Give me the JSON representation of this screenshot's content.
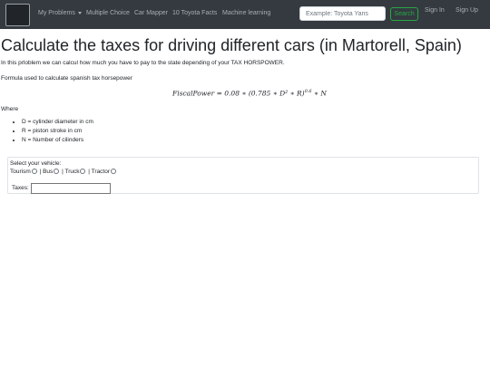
{
  "nav": {
    "items": [
      "My Problems",
      "Multiple Choice",
      "Car Mapper",
      "10 Toyota Facts",
      "Machine learning"
    ],
    "search_placeholder": "Example: Toyota Yaris",
    "search_button": "Search",
    "sign_in": "Sign In",
    "sign_up": "Sign Up"
  },
  "main": {
    "title": "Calculate the taxes for driving different cars (in Martorell, Spain)",
    "intro": "In this prloblem we can calcul how much you have to pay to the state depending of your TAX HORSPOWER.",
    "formula_label": "Formula used to calculate spanish tax horsepower",
    "formula": "FiscalPower = 0.08 ∗ (0.785 ∗ D² ∗ R)",
    "formula_exponent": "0.6",
    "formula_tail": " ∗ N",
    "where_label": "Where",
    "variables": [
      "D = cylinder diameter in cm",
      "R = piston stroke in cm",
      "N = Number of cilinders"
    ]
  },
  "vehicle": {
    "select_label": "Select your vehicle:",
    "options": [
      "Tourism",
      "Bus",
      "Truck",
      "Tractor"
    ],
    "taxes_label": "Taxes:",
    "taxes_value": ""
  }
}
